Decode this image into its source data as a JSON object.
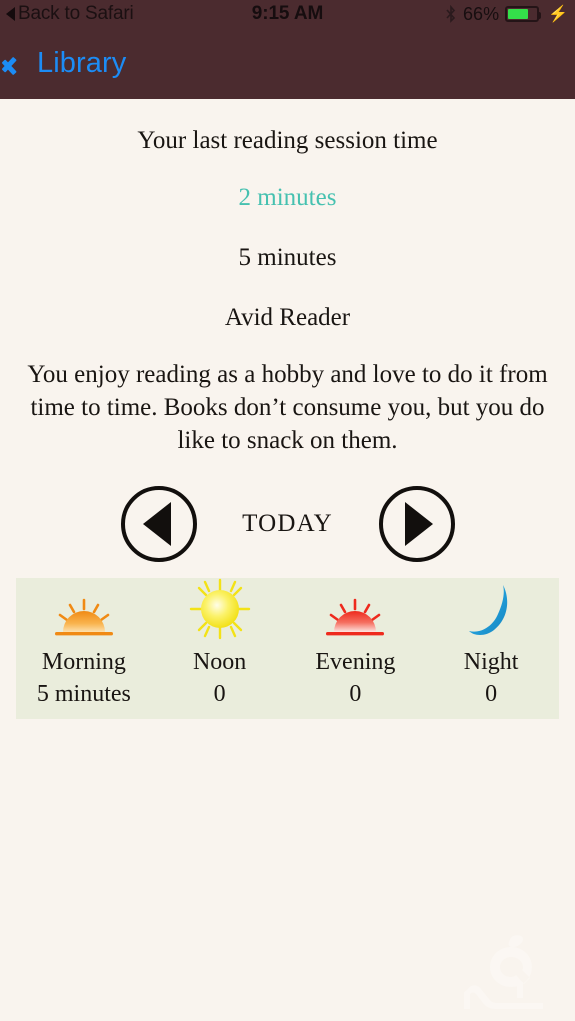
{
  "status_bar": {
    "back_label": "Back to Safari",
    "back_icon": "back-triangle-icon",
    "time": "9:15 AM",
    "bluetooth_icon": "bluetooth-icon",
    "battery_percent": "66%",
    "battery_level": 66,
    "charging_icon": "lightning-bolt-icon",
    "battery_color": "#34e04a",
    "bar_color": "#4b2b2f"
  },
  "nav_bar": {
    "back_icon": "chevron-left-icon",
    "back_label": "Library",
    "accent_color": "#1c8cf5",
    "bar_color": "#4b2b2f"
  },
  "content": {
    "session_title": "Your last reading session time",
    "session_value": "2 minutes",
    "session_value_color": "#46c1b0",
    "goal_value": "5 minutes",
    "rank_title": "Avid Reader",
    "rank_description": "You enjoy reading as a hobby and love to do it from time to time. Books don’t consume you, but you do like to snack on them."
  },
  "day_nav": {
    "prev_icon": "circle-left-arrow-icon",
    "prev_label": "previous-day",
    "label": "TODAY",
    "next_icon": "circle-right-arrow-icon",
    "next_label": "next-day"
  },
  "stats_panel": {
    "background_color": "#eaeddc",
    "columns": [
      {
        "icon": "sunrise-icon",
        "label": "Morning",
        "value": "5 minutes",
        "icon_color": "#f59b27"
      },
      {
        "icon": "sun-icon",
        "label": "Noon",
        "value": "0",
        "icon_color": "#f5e622"
      },
      {
        "icon": "sunset-icon",
        "label": "Evening",
        "value": "0",
        "icon_color": "#ef3224"
      },
      {
        "icon": "moon-icon",
        "label": "Night",
        "value": "0",
        "icon_color": "#27a3dd"
      }
    ]
  },
  "watermark": {
    "icon": "app-logo-watermark-icon"
  }
}
